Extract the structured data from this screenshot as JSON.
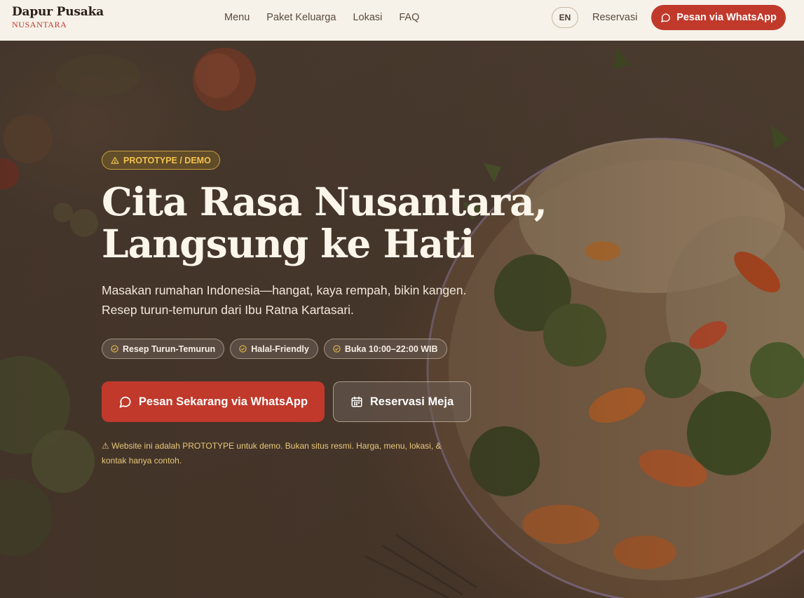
{
  "header": {
    "brand_name": "Dapur Pusaka",
    "brand_sub": "NUSANTARA",
    "nav": [
      "Menu",
      "Paket Keluarga",
      "Lokasi",
      "FAQ"
    ],
    "lang_label": "EN",
    "reservation_label": "Reservasi",
    "whatsapp_label": "Pesan via WhatsApp"
  },
  "hero": {
    "badge": "PROTOTYPE / DEMO",
    "headline_line1": "Cita Rasa Nusantara,",
    "headline_line2": "Langsung ke Hati",
    "subhead_line1": "Masakan rumahan Indonesia—hangat, kaya rempah, bikin kangen.",
    "subhead_line2": "Resep turun-temurun dari Ibu Ratna Kartasari.",
    "chips": [
      "Resep Turun-Temurun",
      "Halal-Friendly",
      "Buka 10:00–22:00 WIB"
    ],
    "cta_whatsapp": "Pesan Sekarang via WhatsApp",
    "cta_reservation": "Reservasi Meja",
    "disclaimer": "⚠ Website ini adalah PROTOTYPE untuk demo. Bukan situs resmi. Harga, menu, lokasi, & kontak hanya contoh."
  },
  "colors": {
    "brand_red": "#c0392b",
    "header_bg": "#f6f2ea",
    "badge_gold": "#f2c14e",
    "hero_text": "#fbf5ea"
  }
}
